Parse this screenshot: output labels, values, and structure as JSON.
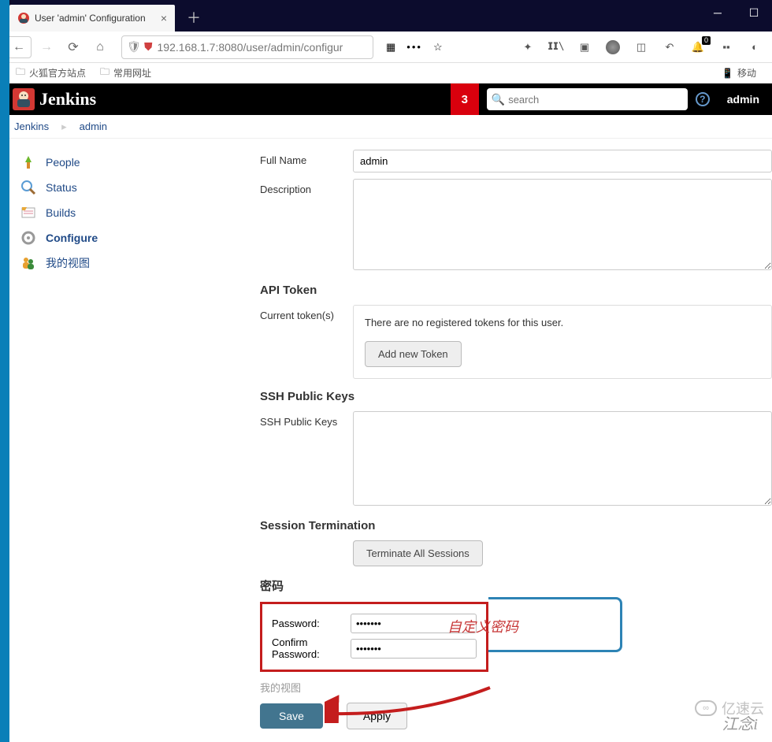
{
  "browser": {
    "tab_title": "User 'admin' Configuration",
    "url": "192.168.1.7:8080/user/admin/configur",
    "bookmarks": [
      {
        "label": "火狐官方站点"
      },
      {
        "label": "常用网址"
      }
    ],
    "mobile_label": "移动",
    "notif_badge": "0"
  },
  "jenkins": {
    "brand": "Jenkins",
    "notif_count": "3",
    "search_placeholder": "search",
    "user": "admin"
  },
  "breadcrumbs": [
    {
      "label": "Jenkins"
    },
    {
      "label": "admin"
    }
  ],
  "sidebar": {
    "items": [
      {
        "label": "People",
        "active": false
      },
      {
        "label": "Status",
        "active": false
      },
      {
        "label": "Builds",
        "active": false
      },
      {
        "label": "Configure",
        "active": true
      },
      {
        "label": "我的视图",
        "active": false
      }
    ]
  },
  "form": {
    "full_name_label": "Full Name",
    "full_name_value": "admin",
    "description_label": "Description",
    "description_value": "",
    "api_token_title": "API Token",
    "current_tokens_label": "Current token(s)",
    "no_tokens_msg": "There are no registered tokens for this user.",
    "add_token_btn": "Add new Token",
    "ssh_title": "SSH Public Keys",
    "ssh_label": "SSH Public Keys",
    "ssh_value": "",
    "session_title": "Session Termination",
    "terminate_btn": "Terminate All Sessions",
    "pw_title": "密码",
    "pw_label": "Password:",
    "pw_value": "•••••••",
    "pw_confirm_label": "Confirm Password:",
    "pw_confirm_value": "•••••••",
    "annotation": "自定义密码",
    "dim_label": "我的视图",
    "save_btn": "Save",
    "apply_btn": "Apply"
  },
  "watermarks": {
    "w1": "江念i",
    "w2": "亿速云"
  }
}
